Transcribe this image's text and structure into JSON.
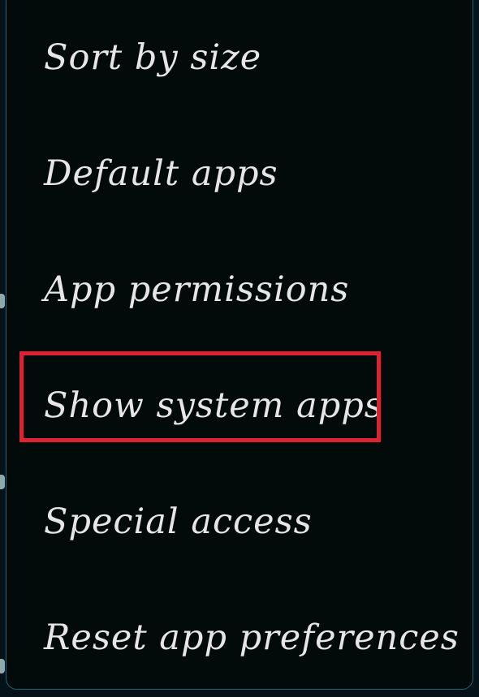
{
  "menu": {
    "items": [
      {
        "label": "Sort by size"
      },
      {
        "label": "Default apps"
      },
      {
        "label": "App permissions"
      },
      {
        "label": "Show system apps"
      },
      {
        "label": "Special access"
      },
      {
        "label": "Reset app preferences"
      }
    ]
  },
  "annotation": {
    "highlighted_item": "Show system apps",
    "color": "#e02230"
  },
  "colors": {
    "menu_background": "#020a0a",
    "menu_border": "#1f6770",
    "text": "#e6e6e6"
  }
}
